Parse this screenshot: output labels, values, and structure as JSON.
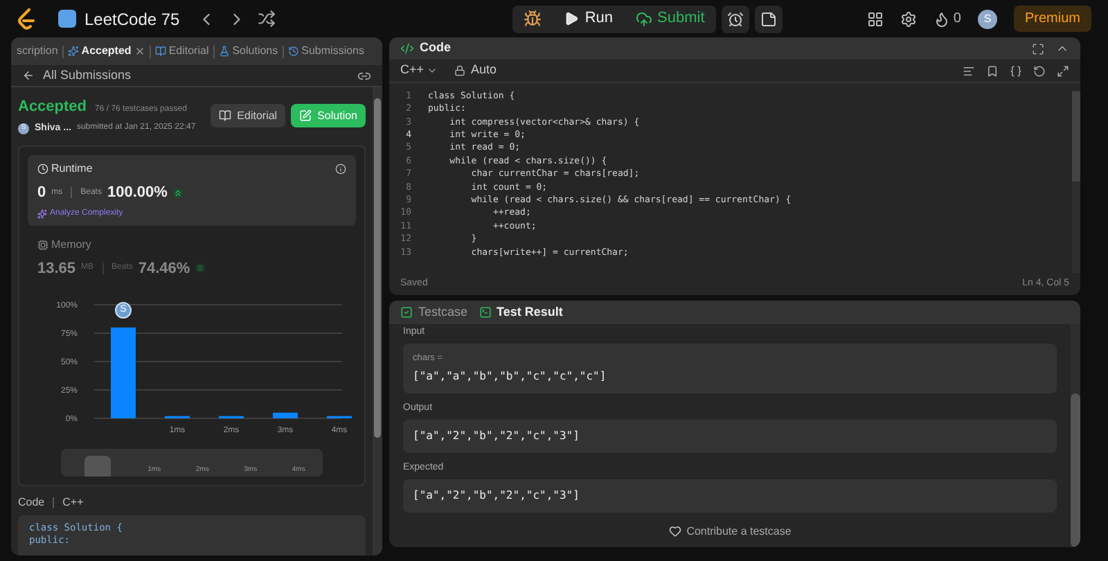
{
  "top_bar": {
    "title": "LeetCode 75",
    "run": "Run",
    "submit": "Submit",
    "streak": "0",
    "avatar": "S",
    "premium": "Premium"
  },
  "left_panel": {
    "tabs": [
      {
        "label": "scription",
        "selected": false,
        "closable": false
      },
      {
        "label": "Accepted",
        "selected": true,
        "closable": true
      },
      {
        "label": "Editorial",
        "selected": false,
        "closable": false
      },
      {
        "label": "Solutions",
        "selected": false,
        "closable": false
      },
      {
        "label": "Submissions",
        "selected": false,
        "closable": false
      }
    ],
    "back_link": "All Submissions",
    "status": "Accepted",
    "testcases": "76 / 76 testcases passed",
    "user": "Shiva ...",
    "user_avatar": "S",
    "submitted": "submitted at Jan 21, 2025 22:47",
    "editorial_button": "Editorial",
    "solution_button": "Solution",
    "stats": [
      {
        "title": "Runtime",
        "value": "0",
        "unit": "ms",
        "beats_label": "Beats",
        "beats": "100.00%",
        "selected": true,
        "analyze": "Analyze Complexity"
      },
      {
        "title": "Memory",
        "value": "13.65",
        "unit": "MB",
        "beats_label": "Beats",
        "beats": "74.46%",
        "selected": false
      }
    ],
    "chart_data": {
      "type": "bar",
      "grid": true,
      "categories": [
        null,
        "1ms",
        "2ms",
        "3ms",
        "4ms"
      ],
      "values": [
        80,
        2,
        2,
        5,
        2
      ],
      "ylim": [
        0,
        100
      ],
      "yticks": [
        {
          "value": 0,
          "label": "0%"
        },
        {
          "value": 25,
          "label": "25%"
        },
        {
          "value": 50,
          "label": "50%"
        },
        {
          "value": 75,
          "label": "75%"
        },
        {
          "value": 100,
          "label": "100%"
        }
      ]
    },
    "chart_marker": "S",
    "navigator_labels": [
      "1ms",
      "2ms",
      "3ms",
      "4ms"
    ],
    "code_label": "Code",
    "language": "C++",
    "code_lines": [
      "class Solution {",
      "public:"
    ]
  },
  "editor": {
    "title": "Code",
    "language": "C++",
    "mode": "Auto",
    "lines": [
      {
        "number": "1",
        "text": "class Solution {",
        "current": false
      },
      {
        "number": "2",
        "text": "public:",
        "current": false
      },
      {
        "number": "3",
        "text": "    int compress(vector<char>& chars) {",
        "current": false
      },
      {
        "number": "4",
        "text": "    int write = 0;",
        "current": true
      },
      {
        "number": "5",
        "text": "    int read = 0;",
        "current": false
      },
      {
        "number": "6",
        "text": "    while (read < chars.size()) {",
        "current": false
      },
      {
        "number": "7",
        "text": "        char currentChar = chars[read];",
        "current": false
      },
      {
        "number": "8",
        "text": "        int count = 0;",
        "current": false
      },
      {
        "number": "9",
        "text": "        while (read < chars.size() && chars[read] == currentChar) {",
        "current": false
      },
      {
        "number": "10",
        "text": "            ++read;",
        "current": false
      },
      {
        "number": "11",
        "text": "            ++count;",
        "current": false
      },
      {
        "number": "12",
        "text": "        }",
        "current": false
      },
      {
        "number": "13",
        "text": "        chars[write++] = currentChar;",
        "current": false
      }
    ],
    "status": "Saved",
    "cursor": "Ln 4, Col 5"
  },
  "results": {
    "tabs": [
      {
        "label": "Testcase",
        "selected": false
      },
      {
        "label": "Test Result",
        "selected": true
      }
    ],
    "sections": [
      {
        "label": "Input",
        "param": "chars =",
        "value": "[\"a\",\"a\",\"b\",\"b\",\"c\",\"c\",\"c\"]"
      },
      {
        "label": "Output",
        "value": "[\"a\",\"2\",\"b\",\"2\",\"c\",\"3\"]"
      },
      {
        "label": "Expected",
        "value": "[\"a\",\"2\",\"b\",\"2\",\"c\",\"3\"]"
      }
    ],
    "contribute": "Contribute a testcase"
  }
}
